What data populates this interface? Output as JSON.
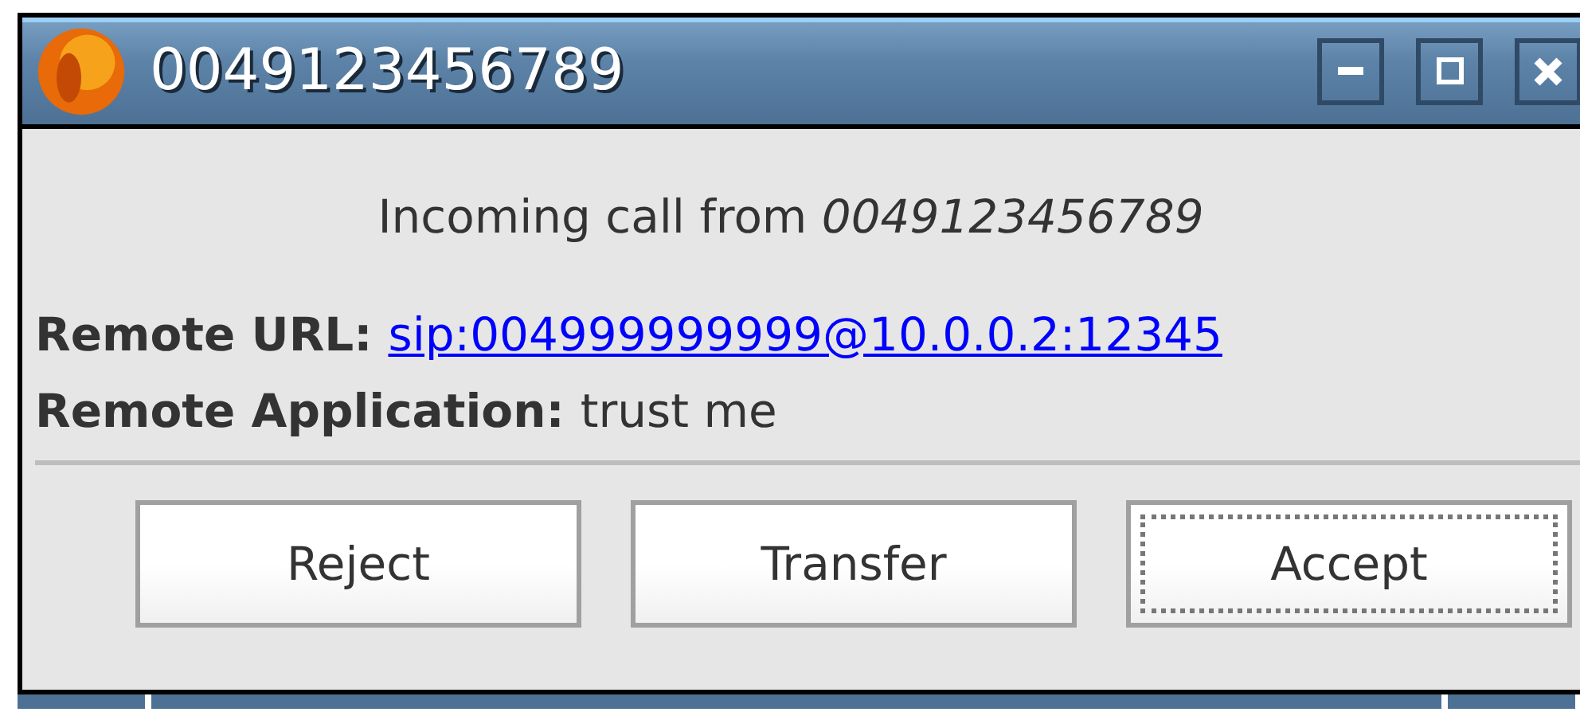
{
  "window": {
    "title": "0049123456789"
  },
  "message": "Incoming call from *0049123456789*",
  "details": [
    {
      "label": "Remote URL:",
      "value": "sip:004999999999@10.0.0.2:12345",
      "kind": "link"
    },
    {
      "label": "Remote Application:",
      "value": "trust me",
      "kind": "text"
    }
  ],
  "buttons": [
    {
      "label": "Reject",
      "focused": false
    },
    {
      "label": "Transfer",
      "focused": false
    },
    {
      "label": "Accept",
      "focused": true
    }
  ]
}
